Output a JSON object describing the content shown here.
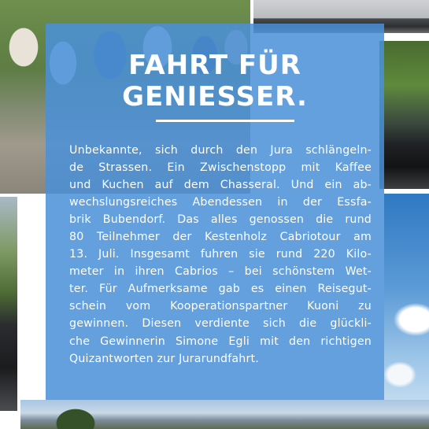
{
  "article": {
    "title_lines": [
      "FAHRT FÜR",
      "GENIESSER."
    ],
    "body_lines": [
      "Unbekannte, sich durch den Jura schlängeln-",
      "de Strassen. Ein Zwischenstopp mit Kaffee",
      "und Kuchen auf dem Chasseral. Und ein ab-",
      "wechslungsreiches Abendessen in der Essfa-",
      "brik Bubendorf. Das alles genossen die rund",
      "80 Teilnehmer der Kestenholz Cabriotour am",
      "13. Juli. Insgesamt fuhren sie rund 220 Kilo-",
      "meter in ihren Cabrios – bei schönstem Wet-",
      "ter. Für Aufmerksame gab es einen Reisegut-",
      "schein vom Kooperationspartner Kuoni zu",
      "gewinnen. Diesen verdiente sich die glückli-",
      "che Gewinnerin Simone Egli mit den richtigen",
      "Quizantworten zur Jurarundfahrt."
    ]
  },
  "colors": {
    "panel": "#4a90d9",
    "text": "#ffffff"
  }
}
